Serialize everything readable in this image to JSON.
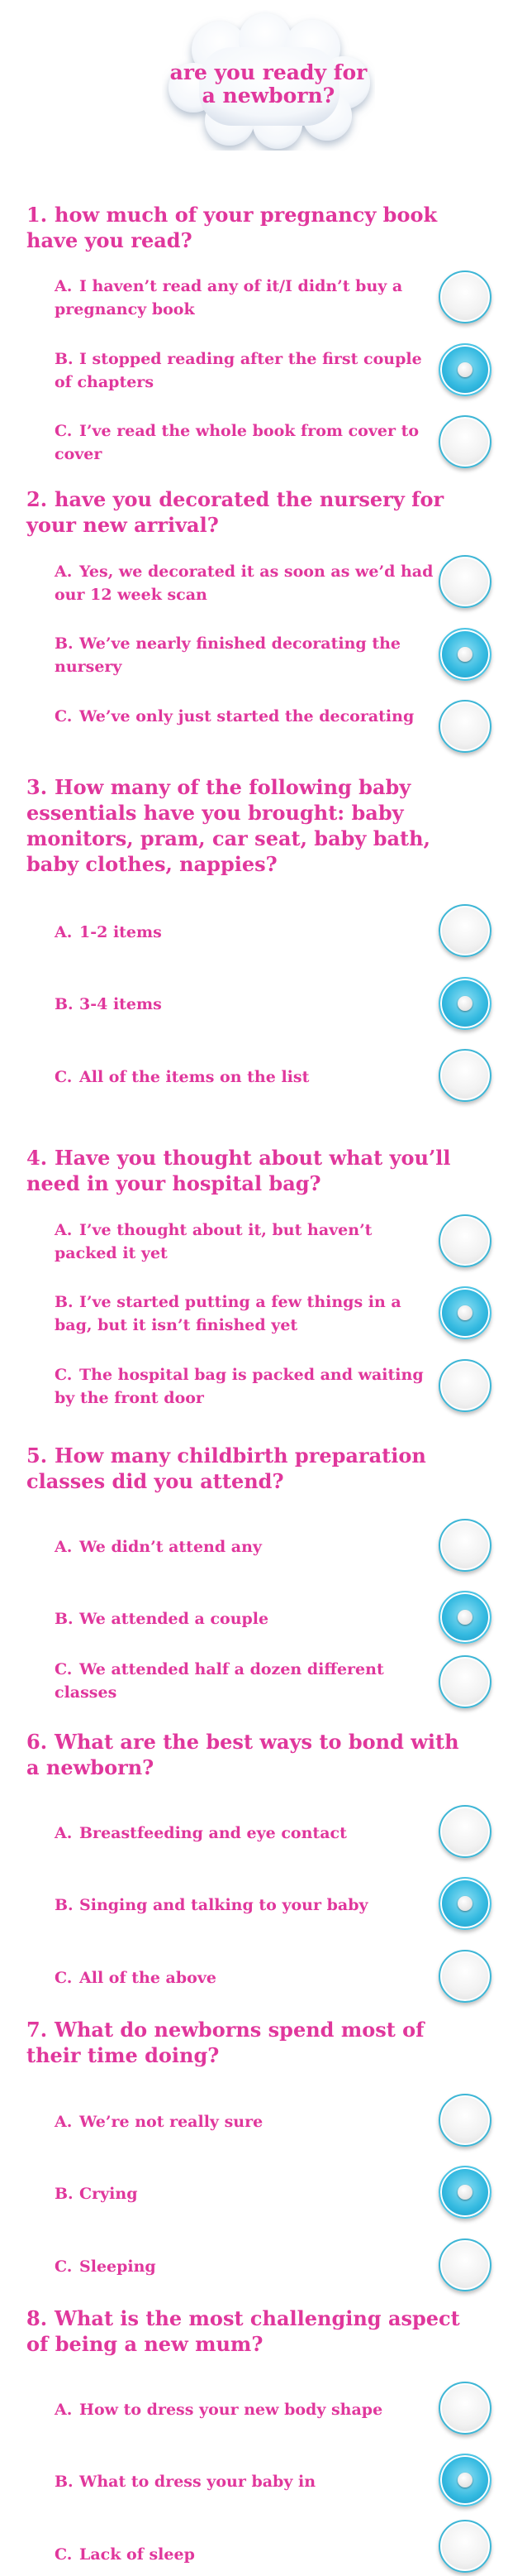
{
  "header": {
    "title": "are you ready for a newborn?"
  },
  "questions": [
    {
      "number": "1.",
      "text": "how much of your pregnancy book have you read?",
      "options": [
        {
          "letter": "A.",
          "text": "I haven’t read any of it/I didn’t buy a pregnancy book",
          "selected": false
        },
        {
          "letter": "B.",
          "text": "I stopped reading after the first couple of chapters",
          "selected": true
        },
        {
          "letter": "C.",
          "text": "I’ve read the whole book from cover to cover",
          "selected": false
        }
      ]
    },
    {
      "number": "2.",
      "text": "have you decorated the nursery for your new arrival?",
      "options": [
        {
          "letter": "A.",
          "text": "Yes, we decorated it as soon as we’d had our 12 week scan",
          "selected": false
        },
        {
          "letter": "B.",
          "text": "We’ve nearly finished decorating the nursery",
          "selected": true
        },
        {
          "letter": "C.",
          "text": "We’ve only just started the decorating",
          "selected": false
        }
      ]
    },
    {
      "number": "3.",
      "text": "How many of the following baby essentials have you brought: baby monitors, pram, car seat, baby bath, baby clothes, nappies?",
      "options": [
        {
          "letter": "A.",
          "text": "1-2 items",
          "selected": false
        },
        {
          "letter": "B.",
          "text": "3-4 items",
          "selected": true
        },
        {
          "letter": "C.",
          "text": "All of the items on the list",
          "selected": false
        }
      ]
    },
    {
      "number": "4.",
      "text": "Have you thought about what you’ll need in your hospital bag?",
      "options": [
        {
          "letter": "A.",
          "text": "I’ve thought about it, but haven’t packed it yet",
          "selected": false
        },
        {
          "letter": "B.",
          "text": "I’ve started putting a few things in a bag, but it isn’t finished yet",
          "selected": true
        },
        {
          "letter": "C.",
          "text": "The hospital bag is packed and waiting by the front door",
          "selected": false
        }
      ]
    },
    {
      "number": "5.",
      "text": "How many childbirth preparation classes did you attend?",
      "options": [
        {
          "letter": "A.",
          "text": "We didn’t attend any",
          "selected": false
        },
        {
          "letter": "B.",
          "text": "We attended a couple",
          "selected": true
        },
        {
          "letter": "C.",
          "text": "We attended half a dozen different classes",
          "selected": false
        }
      ]
    },
    {
      "number": "6.",
      "text": "What are the best ways to bond with a newborn?",
      "options": [
        {
          "letter": "A.",
          "text": "Breastfeeding and eye contact",
          "selected": false
        },
        {
          "letter": "B.",
          "text": "Singing and talking to your baby",
          "selected": true
        },
        {
          "letter": "C.",
          "text": "All of the above",
          "selected": false
        }
      ]
    },
    {
      "number": "7.",
      "text": "What do newborns spend most of their time doing?",
      "options": [
        {
          "letter": "A.",
          "text": "We’re not really sure",
          "selected": false
        },
        {
          "letter": "B.",
          "text": "Crying",
          "selected": true
        },
        {
          "letter": "C.",
          "text": "Sleeping",
          "selected": false
        }
      ]
    },
    {
      "number": "8.",
      "text": "What is the most challenging aspect of being a new mum?",
      "options": [
        {
          "letter": "A.",
          "text": "How to dress your new body shape",
          "selected": false
        },
        {
          "letter": "B.",
          "text": "What to dress your baby in",
          "selected": true
        },
        {
          "letter": "C.",
          "text": "Lack of sleep",
          "selected": false
        }
      ]
    }
  ]
}
